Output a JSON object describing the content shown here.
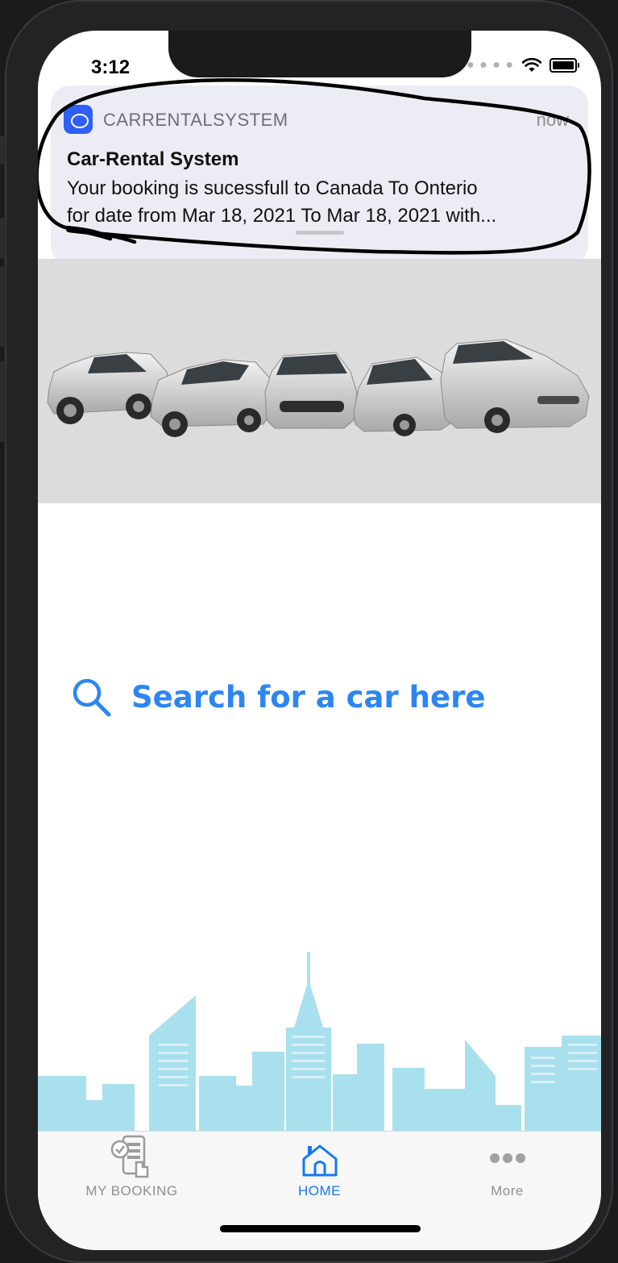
{
  "status_bar": {
    "time": "3:12"
  },
  "notification": {
    "app_name": "CARRENTALSYSTEM",
    "time": "now",
    "title": "Car-Rental System",
    "body_line1": "Your booking is sucessfull to Canada To Onterio",
    "body_line2": "for date from Mar 18, 2021 To Mar 18, 2021 with..."
  },
  "search": {
    "label": "Search for a car here",
    "icon": "search-icon"
  },
  "tab_bar": {
    "items": [
      {
        "label": "MY BOOKING",
        "icon": "booking-phone-icon",
        "active": false
      },
      {
        "label": "HOME",
        "icon": "home-icon",
        "active": true
      },
      {
        "label": "More",
        "icon": "more-dots-icon",
        "active": false
      }
    ]
  },
  "colors": {
    "accent": "#2c86f2",
    "tab_active": "#1677f5",
    "notification_bg": "#ecedf4",
    "skyline": "#a9e0ee"
  }
}
